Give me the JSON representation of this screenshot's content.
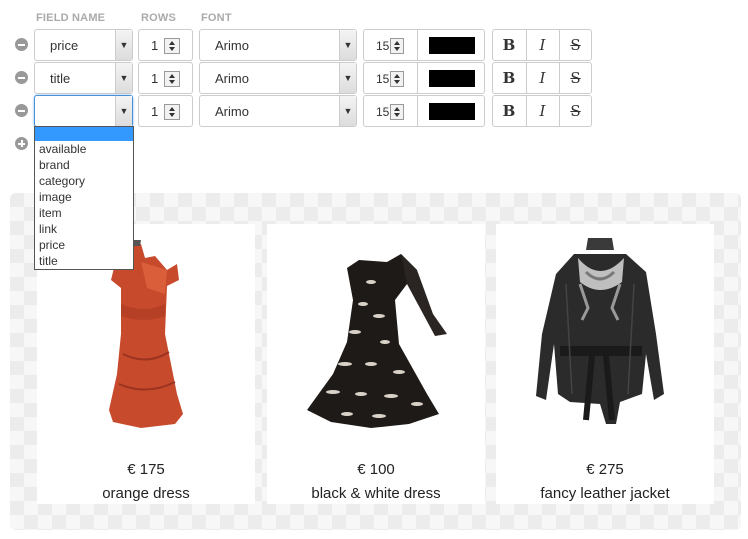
{
  "headers": {
    "field_name": "FIELD NAME",
    "rows": "ROWS",
    "font": "FONT"
  },
  "fields": [
    {
      "name": "price",
      "rows": "1",
      "font": "Arimo",
      "size": "15",
      "color": "#000000"
    },
    {
      "name": "title",
      "rows": "1",
      "font": "Arimo",
      "size": "15",
      "color": "#000000"
    },
    {
      "name": "",
      "rows": "1",
      "font": "Arimo",
      "size": "15",
      "color": "#000000"
    }
  ],
  "style_buttons": {
    "bold": "B",
    "italic": "I",
    "strike": "S"
  },
  "dropdown_options": [
    "",
    "available",
    "brand",
    "category",
    "image",
    "item",
    "link",
    "price",
    "title"
  ],
  "products": [
    {
      "price": "€ 175",
      "name": "orange dress",
      "image": "orange-dress"
    },
    {
      "price": "€ 100",
      "name": "black & white dress",
      "image": "black-white-dress"
    },
    {
      "price": "€ 275",
      "name": "fancy leather jacket",
      "image": "leather-jacket"
    }
  ],
  "colors": {
    "highlight": "#3399ff",
    "focus_border": "#4a90d9",
    "swatch": "#000000"
  }
}
